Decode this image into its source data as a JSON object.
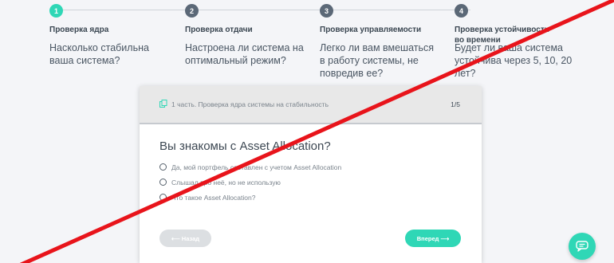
{
  "steps": [
    {
      "num": "1",
      "title": "Проверка ядра",
      "desc": "Насколько стабильна ваша система?"
    },
    {
      "num": "2",
      "title": "Проверка отдачи",
      "desc": "Настроена ли система на оптимальный режим?"
    },
    {
      "num": "3",
      "title": "Проверка управляемости",
      "desc": "Легко ли вам вмешаться в работу системы, не повредив ее?"
    },
    {
      "num": "4",
      "title": "Проверка устойчивости во времени",
      "desc": "Будет ли ваша система устойчива через 5, 10, 20 лет?"
    }
  ],
  "quiz": {
    "header": "1 часть. Проверка ядра системы на стабильность",
    "counter": "1/5",
    "question": "Вы знакомы с Asset Allocation?",
    "answers": [
      "Да, мой портфель составлен с учетом Asset Allocation",
      "Слышал про неё, но не использую",
      "Что такое Asset Allocation?"
    ],
    "back_label": "⟵ Назад",
    "next_label": "Вперед ⟶"
  },
  "colors": {
    "accent": "#2fd7b6",
    "step_inactive": "#5b6877",
    "strike": "#e8141b"
  },
  "icons": {
    "header": "document-stack-icon",
    "chat": "chat-bubble-icon"
  }
}
